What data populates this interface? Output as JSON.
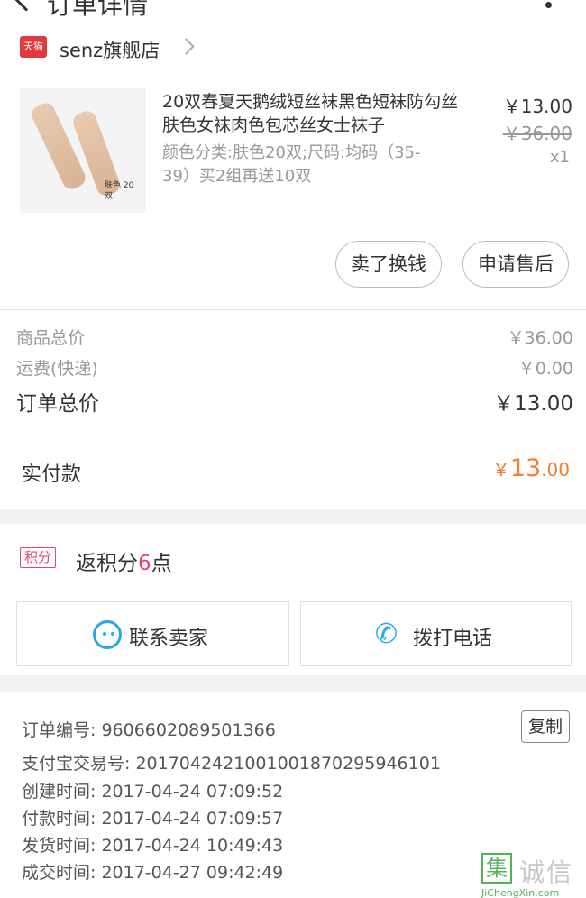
{
  "header": {
    "title": "订单详情"
  },
  "shop": {
    "badge": "天猫",
    "name": "senz旗舰店"
  },
  "product": {
    "title": "20双春夏天鹅绒短丝袜黑色短袜防勾丝肤色女袜肉色包芯丝女士袜子",
    "spec": "颜色分类:肤色20双;尺码:均码（35-39）买2组再送10双",
    "thumb_label": "肤色 20双",
    "price": "￥13.00",
    "original_price": "￥36.00",
    "quantity": "x1"
  },
  "actions": {
    "sell": "卖了换钱",
    "aftersale": "申请售后"
  },
  "summary": {
    "goods_total_label": "商品总价",
    "goods_total_value": "￥36.00",
    "shipping_label": "运费(快递)",
    "shipping_value": "￥0.00",
    "order_total_label": "订单总价",
    "order_total_value": "￥13.00"
  },
  "payment": {
    "label": "实付款",
    "currency": "￥",
    "int": "13",
    "dec": ".00"
  },
  "points": {
    "badge": "积分",
    "prefix": "返积分",
    "num": "6",
    "suffix": "点"
  },
  "contact": {
    "contact_seller": "联系卖家",
    "call": "拨打电话"
  },
  "info": {
    "order_no": "订单编号: 9606602089501366",
    "copy": "复制",
    "alipay_no": "支付宝交易号: 2017042421001001870295946101",
    "created": "创建时间: 2017-04-24 07:09:52",
    "paid": "付款时间: 2017-04-24 07:09:57",
    "shipped": "发货时间: 2017-04-24 10:49:43",
    "completed": "成交时间: 2017-04-27 09:42:49"
  },
  "watermark": {
    "icon": "集",
    "text": "诚信",
    "url": "JiChengXin.com"
  },
  "colors": {
    "accent_orange": "#f37f2b",
    "points_pink": "#e8436a",
    "icon_blue": "#2aa8e6",
    "tmall_red": "#e4393c"
  }
}
